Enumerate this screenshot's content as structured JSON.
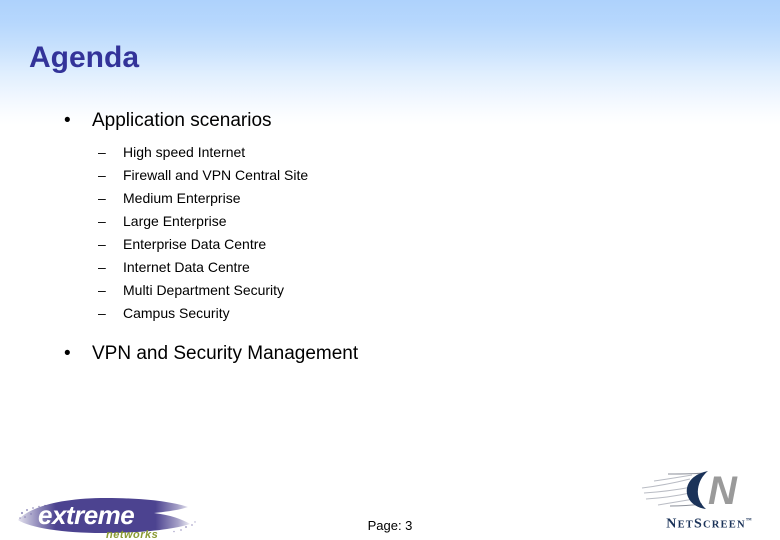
{
  "slide": {
    "title": "Agenda",
    "title_color": "#333399",
    "background_top_color": "#aed2fc",
    "background_bottom_color": "#ffffff"
  },
  "bullets": [
    {
      "marker": "•",
      "text": "Application scenarios",
      "children": [
        {
          "marker": "–",
          "text": "High speed Internet"
        },
        {
          "marker": "–",
          "text": "Firewall and VPN Central Site"
        },
        {
          "marker": "–",
          "text": "Medium Enterprise"
        },
        {
          "marker": "–",
          "text": "Large Enterprise"
        },
        {
          "marker": "–",
          "text": "Enterprise Data Centre"
        },
        {
          "marker": "–",
          "text": "Internet Data Centre"
        },
        {
          "marker": "–",
          "text": "Multi Department Security"
        },
        {
          "marker": "–",
          "text": "Campus Security"
        }
      ]
    },
    {
      "marker": "•",
      "text": "VPN and Security Management",
      "children": []
    }
  ],
  "footer": {
    "page_label": "Page: 3"
  },
  "logos": {
    "extreme": {
      "name": "extreme-networks-logo",
      "primary_text": "extreme",
      "secondary_text": "networks",
      "brush_color": "#4c4390",
      "primary_text_color": "#ffffff",
      "secondary_text_color": "#8a9a33"
    },
    "netscreen": {
      "name": "netscreen-logo",
      "wordmark_lead": "N",
      "wordmark_rest_1": "ET",
      "wordmark_mid": "S",
      "wordmark_rest_2": "CREEN",
      "trademark": "™",
      "mark_letter": "N",
      "mark_crescent_color": "#1b3359",
      "mark_letter_color": "#9a9a9a",
      "wordmark_color": "#1b3359"
    }
  }
}
